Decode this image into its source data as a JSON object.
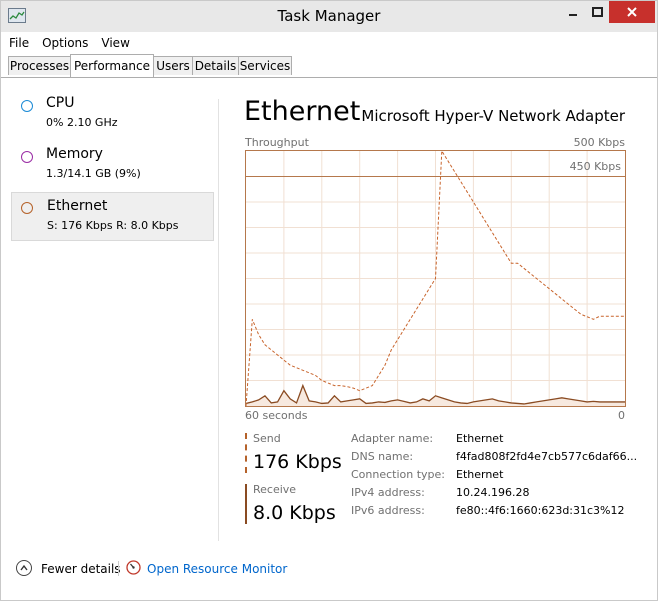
{
  "window": {
    "title": "Task Manager"
  },
  "menu": [
    "File",
    "Options",
    "View"
  ],
  "tabs": [
    "Processes",
    "Performance",
    "Users",
    "Details",
    "Services"
  ],
  "sidebar": {
    "items": [
      {
        "title": "CPU",
        "sub": "0% 2.10 GHz",
        "color": "#1c8bd6"
      },
      {
        "title": "Memory",
        "sub": "1.3/14.1 GB (9%)",
        "color": "#9a2da5"
      },
      {
        "title": "Ethernet",
        "sub": "S: 176 Kbps R: 8.0 Kbps",
        "color": "#b5622a"
      }
    ]
  },
  "main": {
    "title": "Ethernet",
    "adapter": "Microsoft Hyper-V Network Adapter",
    "throughput_label": "Throughput",
    "max_label": "500 Kbps",
    "line_label": "450 Kbps",
    "time_left": "60 seconds",
    "time_right": "0"
  },
  "stats": {
    "send_label": "Send",
    "send_value": "176 Kbps",
    "receive_label": "Receive",
    "receive_value": "8.0 Kbps"
  },
  "details": [
    {
      "key": "Adapter name:",
      "value": "Ethernet"
    },
    {
      "key": "DNS name:",
      "value": "f4fad808f2fd4e7cb577c6daf66..."
    },
    {
      "key": "Connection type:",
      "value": "Ethernet"
    },
    {
      "key": "IPv4 address:",
      "value": "10.24.196.28"
    },
    {
      "key": "IPv6 address:",
      "value": "fe80::4f6:1660:623d:31c3%12"
    }
  ],
  "footer": {
    "fewer_details": "Fewer details",
    "open_monitor": "Open Resource Monitor"
  },
  "colors": {
    "accent": "#b5622a",
    "link": "#0066cc",
    "close": "#c7302c"
  },
  "graph": {
    "max_kbps": 500,
    "marker_kbps": 450,
    "send": [
      0,
      170,
      140,
      120,
      110,
      100,
      90,
      80,
      75,
      70,
      65,
      60,
      50,
      45,
      40,
      40,
      38,
      35,
      30,
      35,
      40,
      60,
      80,
      110,
      130,
      150,
      170,
      190,
      210,
      230,
      250,
      500,
      480,
      460,
      440,
      420,
      400,
      380,
      360,
      340,
      320,
      300,
      280,
      280,
      270,
      260,
      250,
      240,
      230,
      220,
      210,
      200,
      190,
      180,
      175,
      170,
      176,
      176,
      176,
      176,
      176
    ],
    "receive": [
      5,
      8,
      12,
      20,
      6,
      8,
      30,
      14,
      6,
      40,
      10,
      8,
      5,
      6,
      20,
      8,
      10,
      12,
      14,
      5,
      6,
      8,
      7,
      10,
      12,
      9,
      6,
      8,
      14,
      10,
      20,
      16,
      12,
      8,
      6,
      5,
      8,
      10,
      12,
      14,
      10,
      8,
      6,
      5,
      4,
      6,
      8,
      10,
      12,
      14,
      16,
      14,
      12,
      10,
      8,
      9,
      8,
      8,
      8,
      8,
      8
    ]
  }
}
